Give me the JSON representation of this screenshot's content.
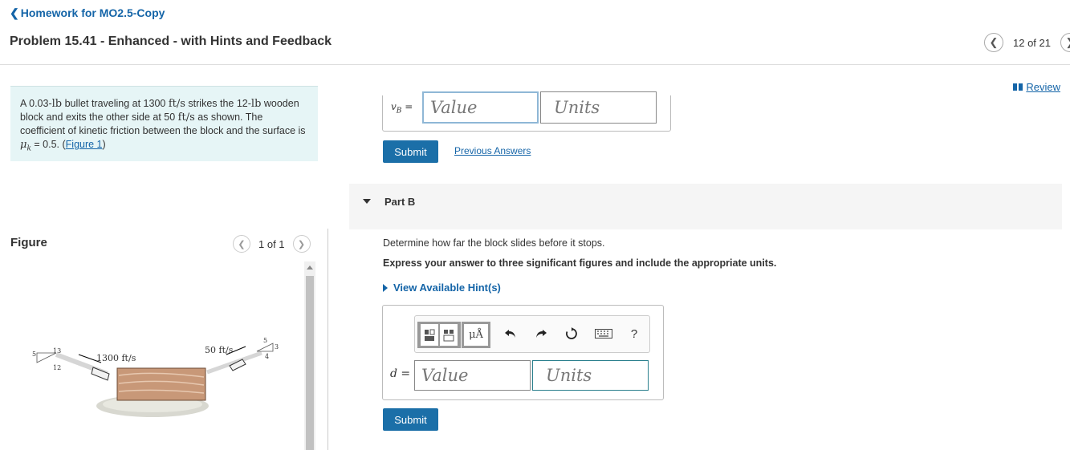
{
  "header": {
    "back_label": "Homework for MO2.5-Copy",
    "title": "Problem 15.41 - Enhanced - with Hints and Feedback",
    "pager": "12 of 21",
    "review_label": "Review"
  },
  "problem": {
    "text_1": "A 0.03-",
    "unit_lb_1": "lb",
    "text_2": " bullet traveling at 1300 ",
    "unit_fts_1": "ft/s",
    "text_3": " strikes the 12-",
    "unit_lb_2": "lb",
    "text_4": " wooden block and exits the other side at 50 ",
    "unit_fts_2": "ft/s",
    "text_5": " as shown. The coefficient of kinetic friction between the block and the surface is ",
    "mu": "μ",
    "mu_sub": "k",
    "text_6": " = 0.5. (",
    "figure_link": "Figure 1",
    "text_7": ")"
  },
  "figure": {
    "heading": "Figure",
    "pager": "1 of 1",
    "labels": {
      "v_in": "1300 ft/s",
      "v_out": "50 ft/s",
      "tri_left_hyp": "13",
      "tri_left_v": "5",
      "tri_left_h": "12",
      "tri_right_hyp": "5",
      "tri_right_v": "3",
      "tri_right_h": "4"
    }
  },
  "part_a": {
    "var": "v",
    "var_sub": "B",
    "equals": " =",
    "value_placeholder": "Value",
    "units_placeholder": "Units",
    "submit_label": "Submit",
    "previous_answers_label": "Previous Answers"
  },
  "part_b": {
    "label": "Part B",
    "question": "Determine how far the block slides before it stops.",
    "instruction": "Express your answer to three significant figures and include the appropriate units.",
    "hint_label": "View Available Hint(s)",
    "var": "d",
    "equals": " =",
    "value_placeholder": "Value",
    "units_placeholder": "Units",
    "submit_label": "Submit",
    "toolbar": {
      "units_glyph": "μÅ",
      "help_glyph": "?"
    }
  },
  "colors": {
    "link": "#1565a8",
    "submit": "#1b6fa8",
    "problem_bg": "#e6f5f6"
  }
}
